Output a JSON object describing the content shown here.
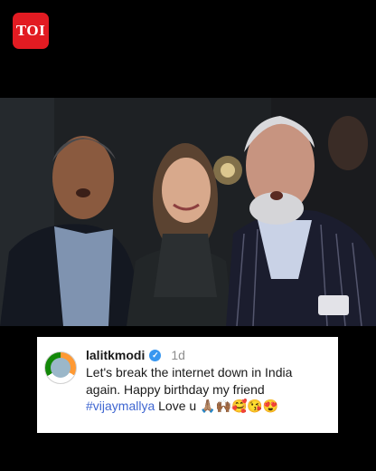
{
  "brand": {
    "logo_text": "TOI",
    "color": "#e21b22"
  },
  "post": {
    "username": "lalitkmodi",
    "verified": true,
    "age": "1d",
    "line1": "Let's break the internet down in India",
    "line2": "again. Happy birthday my friend",
    "hashtag": "#vijaymallya",
    "after_hashtag": "Love u",
    "emojis": "🙏🏽🙌🏾🥰😘😍"
  }
}
